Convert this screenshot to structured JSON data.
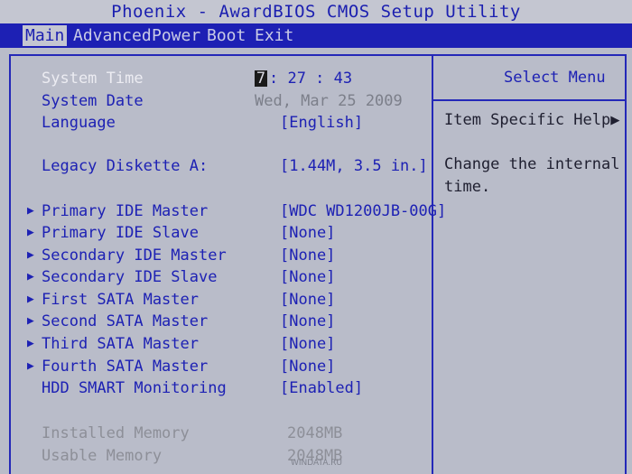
{
  "window": {
    "title": "Phoenix - AwardBIOS CMOS Setup Utility"
  },
  "menu": {
    "items": [
      "Main",
      "Advanced",
      "Power",
      "Boot",
      "Exit"
    ],
    "active": "Main"
  },
  "rows": {
    "system_time": {
      "label": "System Time",
      "cursor": "7",
      "value": ": 27 : 43"
    },
    "system_date": {
      "label": "System Date",
      "value": "Wed, Mar 25 2009"
    },
    "language": {
      "label": "Language",
      "value": "[English]"
    },
    "legacy_diskette": {
      "label": "Legacy Diskette A:",
      "value": "[1.44M, 3.5 in.]"
    },
    "primary_ide_master": {
      "label": "Primary IDE Master",
      "value": "[WDC WD1200JB-00G]"
    },
    "primary_ide_slave": {
      "label": "Primary IDE Slave",
      "value": "[None]"
    },
    "secondary_ide_master": {
      "label": "Secondary IDE Master",
      "value": "[None]"
    },
    "secondary_ide_slave": {
      "label": "Secondary IDE Slave",
      "value": "[None]"
    },
    "first_sata_master": {
      "label": "First SATA Master",
      "value": "[None]"
    },
    "second_sata_master": {
      "label": "Second SATA Master",
      "value": "[None]"
    },
    "third_sata_master": {
      "label": "Third SATA Master",
      "value": "[None]"
    },
    "fourth_sata_master": {
      "label": "Fourth SATA Master",
      "value": "[None]"
    },
    "hdd_smart": {
      "label": "HDD SMART Monitoring",
      "value": "[Enabled]"
    },
    "installed_memory": {
      "label": "Installed Memory",
      "value": "2048MB"
    },
    "usable_memory": {
      "label": "Usable Memory",
      "value": "2048MB"
    }
  },
  "help": {
    "title": "Select Menu",
    "subtitle": "Item Specific Help▶",
    "line1": "Change the internal",
    "line2": "time."
  },
  "watermark": "WINDATA.RU",
  "colors": {
    "screen_bg": "#b9bcc9",
    "menubar_bg": "#1d20b4",
    "text_blue": "#1d21b4",
    "selected_text": "#ececf2"
  }
}
